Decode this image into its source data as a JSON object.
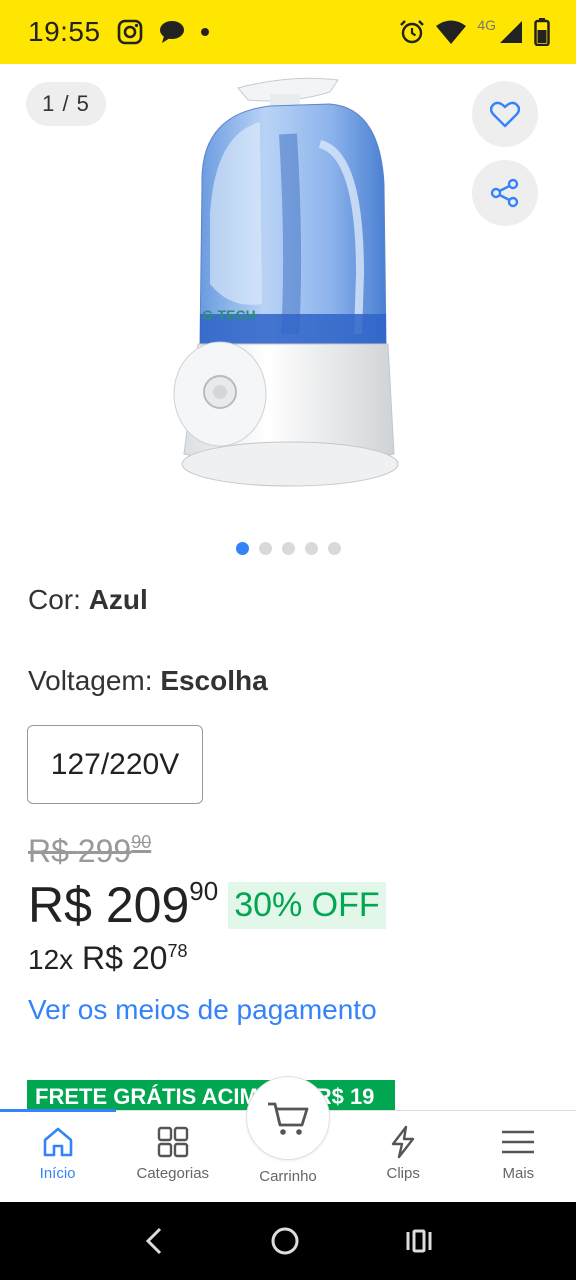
{
  "status_bar": {
    "time": "19:55",
    "network": "4G"
  },
  "gallery": {
    "counter": "1 / 5",
    "total_images": 5,
    "active_image": 1
  },
  "variations": {
    "color_label": "Cor:",
    "color_value": "Azul",
    "voltage_label": "Voltagem:",
    "voltage_value": "Escolha",
    "voltage_option": "127/220V"
  },
  "price": {
    "old_currency": "R$",
    "old_int": "299",
    "old_cents": "90",
    "currency": "R$",
    "int": "209",
    "cents": "90",
    "discount": "30% OFF",
    "installments_count": "12x",
    "installment_currency": "R$",
    "installment_int": "20",
    "installment_cents": "78",
    "payment_link": "Ver os meios de pagamento"
  },
  "shipping_banner": "FRETE GRÁTIS ACIMA DE R$ 19",
  "bottom_nav": {
    "home": "Início",
    "categories": "Categorias",
    "cart": "Carrinho",
    "clips": "Clips",
    "more": "Mais"
  },
  "colors": {
    "accent": "#3483fa",
    "brand_yellow": "#FFE600",
    "discount_green": "#00a650"
  }
}
